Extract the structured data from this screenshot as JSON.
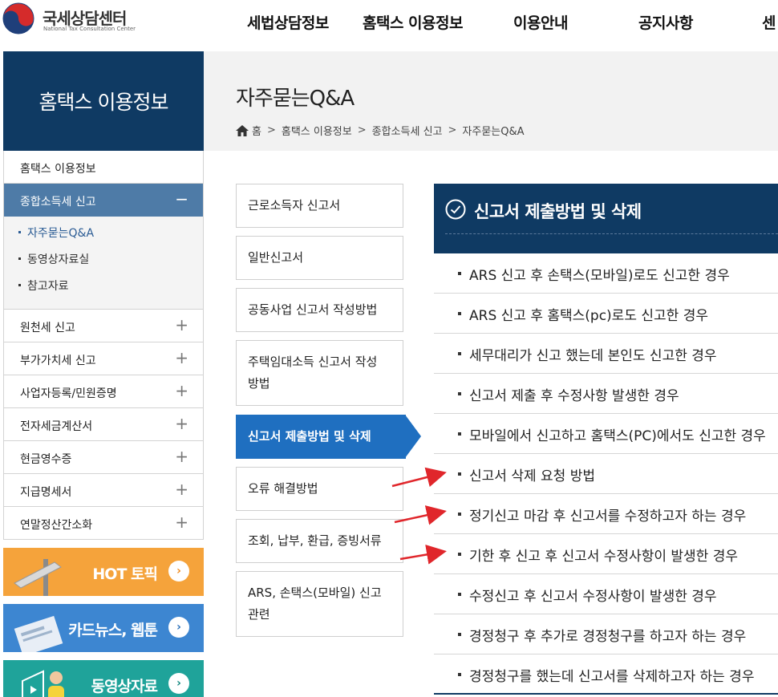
{
  "header": {
    "logo_title": "국세상담센터",
    "logo_subtitle": "National Tax Consultation Center",
    "nav": [
      "세법상담정보",
      "홈택스 이용정보",
      "이용안내",
      "공지사항",
      "센"
    ]
  },
  "page": {
    "title": "자주묻는Q&A",
    "breadcrumb": [
      "홈",
      "홈택스 이용정보",
      "종합소득세 신고",
      "자주묻는Q&A"
    ]
  },
  "sidebar": {
    "title": "홈택스 이용정보",
    "top_item": "홈택스 이용정보",
    "active_item": "종합소득세 신고",
    "active_toggle": "−",
    "sub_items": [
      "자주묻는Q&A",
      "동영상자료실",
      "참고자료"
    ],
    "items": [
      "원천세 신고",
      "부가가치세 신고",
      "사업자등록/민원증명",
      "전자세금계산서",
      "현금영수증",
      "지급명세서",
      "연말정산간소화"
    ],
    "expand_symbol": "+"
  },
  "banners": [
    {
      "label": "HOT 토픽",
      "color": "#f5a33b",
      "arrow_color": "#f08a1c"
    },
    {
      "label": "카드뉴스, 웹툰",
      "color": "#3d86d1",
      "arrow_color": "#2a6fb8"
    },
    {
      "label": "동영상자료",
      "color": "#1fa39a",
      "arrow_color": "#12877f"
    }
  ],
  "banner_arrow": "›",
  "categories": [
    "근로소득자 신고서",
    "일반신고서",
    "공동사업 신고서 작성방법",
    "주택임대소득 신고서 작성 방법",
    "신고서 제출방법 및 삭제",
    "오류 해결방법",
    "조회, 납부, 환급, 증빙서류",
    "ARS, 손택스(모바일) 신고 관련"
  ],
  "qa": {
    "title": "신고서 제출방법 및 삭제",
    "items": [
      "ARS 신고 후 손택스(모바일)로도 신고한 경우",
      "ARS 신고 후 홈택스(pc)로도 신고한 경우",
      "세무대리가 신고 했는데 본인도 신고한 경우",
      "신고서 제출 후 수정사항 발생한 경우",
      "모바일에서 신고하고 홈택스(PC)에서도 신고한 경우",
      "신고서 삭제 요청 방법",
      "정기신고 마감 후 신고서를 수정하고자 하는 경우",
      "기한 후 신고 후 신고서 수정사항이 발생한 경우",
      "수정신고 후 신고서 수정사항이 발생한 경우",
      "경정청구 후 추가로 경정청구를 하고자 하는 경우",
      "경정청구를 했는데 신고서를 삭제하고자 하는 경우"
    ]
  },
  "colors": {
    "navy": "#0f3a63",
    "active_blue": "#1f6fc0",
    "sidebar_active": "#4e7ba7",
    "annotation_arrow": "#e0262b"
  }
}
